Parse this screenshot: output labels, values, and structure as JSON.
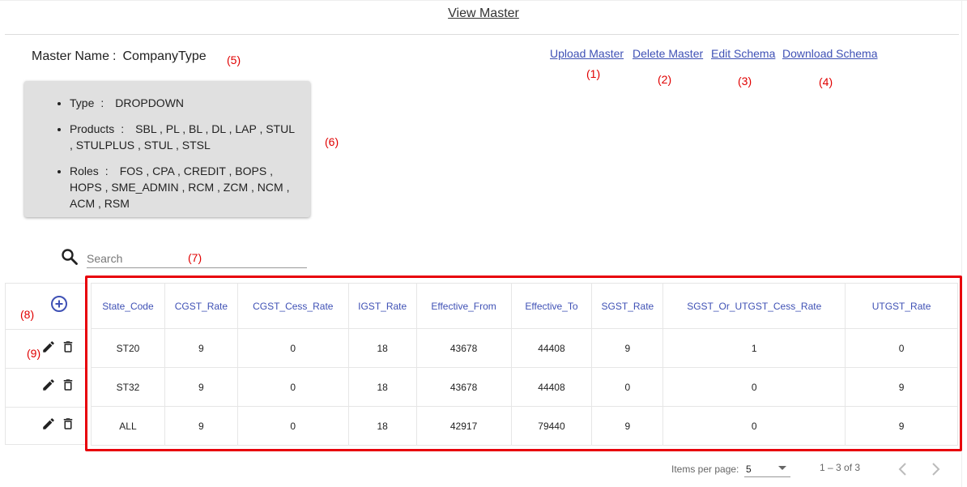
{
  "page": {
    "title": "View Master"
  },
  "master": {
    "label": "Master Name",
    "separator": ":",
    "value": "CompanyType"
  },
  "actions": {
    "upload": "Upload Master",
    "delete": "Delete Master",
    "edit_schema": "Edit Schema",
    "download_schema": "Download Schema"
  },
  "annotations": {
    "n1": "(1)",
    "n2": "(2)",
    "n3": "(3)",
    "n4": "(4)",
    "n5": "(5)",
    "n6": "(6)",
    "n7": "(7)",
    "n8": "(8)",
    "n9": "(9)"
  },
  "info": {
    "type_label": "Type",
    "type_sep": ":",
    "type_value": "DROPDOWN",
    "products_label": "Products",
    "products_sep": ":",
    "products_value": "SBL , PL , BL , DL , LAP , STUL , STULPLUS , STUL , STSL",
    "roles_label": "Roles",
    "roles_sep": ":",
    "roles_value": "FOS , CPA , CREDIT , BOPS , HOPS , SME_ADMIN , RCM , ZCM , NCM , ACM , RSM"
  },
  "search": {
    "placeholder": "Search",
    "icon": "search-icon"
  },
  "table": {
    "columns": [
      "State_Code",
      "CGST_Rate",
      "CGST_Cess_Rate",
      "IGST_Rate",
      "Effective_From",
      "Effective_To",
      "SGST_Rate",
      "SGST_Or_UTGST_Cess_Rate",
      "UTGST_Rate"
    ],
    "rows": [
      [
        "ST20",
        "9",
        "0",
        "18",
        "43678",
        "44408",
        "9",
        "1",
        "0"
      ],
      [
        "ST32",
        "9",
        "0",
        "18",
        "43678",
        "44408",
        "0",
        "0",
        "9"
      ],
      [
        "ALL",
        "9",
        "0",
        "18",
        "42917",
        "79440",
        "9",
        "0",
        "9"
      ]
    ]
  },
  "pagination": {
    "items_per_page_label": "Items per page:",
    "page_size": "5",
    "range": "1 – 3 of 3"
  },
  "colors": {
    "link": "#3f51b5",
    "annotation": "#e00000",
    "highlight_frame": "#e8000b",
    "card": "#e0e0e0"
  }
}
